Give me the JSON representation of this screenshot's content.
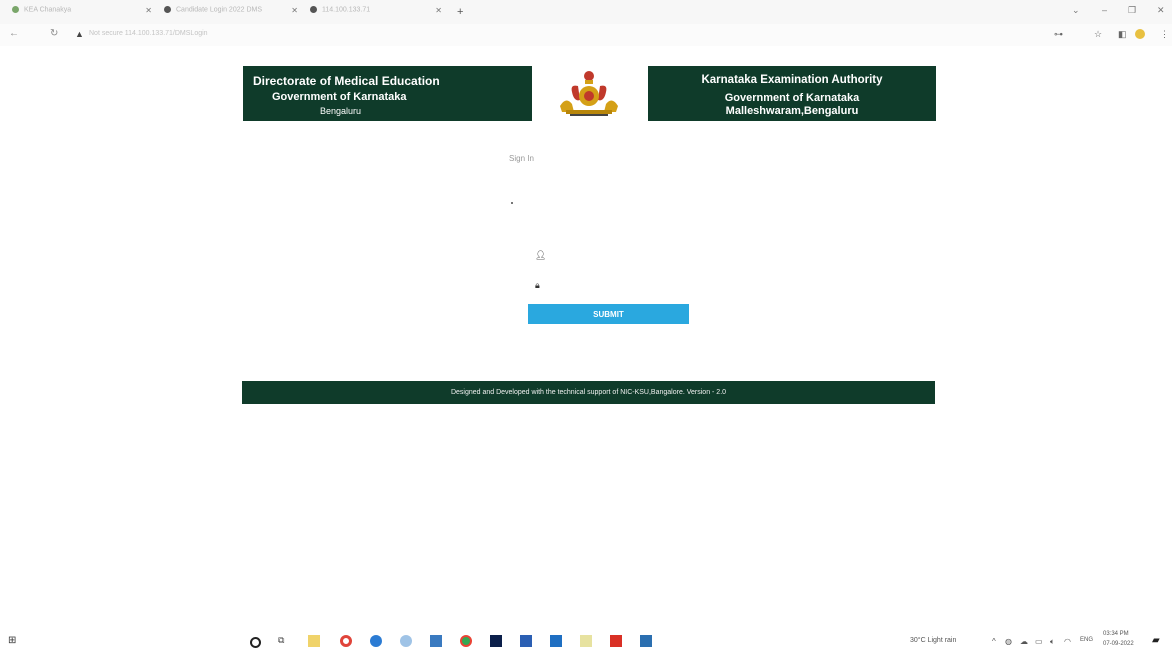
{
  "browser": {
    "tabs": [
      {
        "title": "KEA Chanakya"
      },
      {
        "title": "Candidate Login 2022 DMS"
      },
      {
        "title": "114.100.133.71"
      }
    ],
    "url": "Not secure  114.100.133.71/DMSLogin",
    "new_tab_label": "+"
  },
  "header": {
    "left_line1": "Directorate of Medical Education",
    "left_line2": "Government of Karnataka",
    "left_line3": "Bengaluru",
    "right_line1": "Karnataka Examination Authority",
    "right_line2": "Government of Karnataka",
    "right_line3": "Malleshwaram,Bengaluru"
  },
  "login": {
    "heading": "Sign In",
    "username_placeholder": "",
    "password_placeholder": "",
    "submit_label": "SUBMIT"
  },
  "footer": {
    "text": "Designed and Developed with the technical support of  NIC-KSU,Bangalore.  Version - 2.0"
  },
  "taskbar": {
    "weather": "30°C  Light rain",
    "language": "ENG",
    "time": "03:34 PM",
    "date": "07-09-2022"
  },
  "colors": {
    "header_bg": "#0f3b2a",
    "submit_bg": "#2aa8df",
    "page_bg": "#ffffff"
  }
}
